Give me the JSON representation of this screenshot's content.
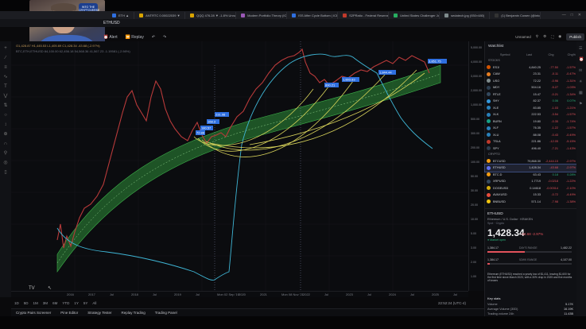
{
  "browser": {
    "tabs": [
      {
        "label": "ETH ▲",
        "color": "#2f6fe0"
      },
      {
        "label": "ANTRTC 0.00022039 ▼",
        "color": "#d9a400"
      },
      {
        "label": "QQQ 476.28 ▼ -1.8% Unna",
        "color": "#d9a400"
      },
      {
        "label": "Modern Portfolio Theory (ICE",
        "color": "#9b59b6"
      },
      {
        "label": "ISS After Cycle Bottom | ICE",
        "color": "#2f6fe0"
      },
      {
        "label": "S2PRatio - Federal Reserve",
        "color": "#c0392b"
      },
      {
        "label": "United States Challenger Jo",
        "color": "#27ae60"
      },
      {
        "label": "sedatech.jpg (930×480)",
        "color": "#7f8c8d"
      },
      {
        "label": "(1) Benjamin Cowen (@into",
        "color": "#333"
      }
    ],
    "symbol": "ETHUSD"
  },
  "toolbar": {
    "alert": "Alert",
    "replay": "Replay",
    "unnamed": "Unnamed",
    "publish": "Publish"
  },
  "legend": {
    "ohlc": "O1,428.87 H1,445.53 L1,405.69 C1,428.34 -43.68 (-2.97%)",
    "indicator": "BTC,ETH,ETHUSD  84,100.00 62,456.18 54,568.36 41,567.23 -1.19581 (-2.98%)"
  },
  "price_scale": [
    "5,000.00",
    "4,000.00",
    "3,000.00",
    "2,000.00",
    "1,000.00",
    "500.00",
    "300.00",
    "200.00",
    "100.00",
    "50.00",
    "30.00",
    "20.00",
    "10.00",
    "5.00",
    "3.00",
    "2.00",
    "1.00"
  ],
  "time_axis": [
    "2016",
    "2017",
    "Jul",
    "2018",
    "Jul",
    "2019",
    "Jul",
    "Mon 02 Sep '19",
    "2020",
    "2021",
    "Mon 08 Nov '21",
    "2022",
    "Jul",
    "2023",
    "Jul",
    "2024",
    "Jul",
    "2025",
    "Jul"
  ],
  "chart_labels": {
    "p1": "72.88",
    "p2": "180.57",
    "p3": "168.3",
    "p4": "231.98",
    "p5": "890.21",
    "p6": "1,893.83",
    "p7": "1,844.44",
    "current": "3,851.75",
    "left_price": "0.4077"
  },
  "timeframes": [
    "1D",
    "5D",
    "1M",
    "3M",
    "6M",
    "YTD",
    "1Y",
    "5Y",
    "All"
  ],
  "clock": "22:52:24 (UTC-4)",
  "bottom_tabs": [
    "Crypto Pairs Screener",
    "Pine Editor",
    "Strategy Tester",
    "Replay Trading",
    "Trading Panel"
  ],
  "watchlist": {
    "title": "Watchlist",
    "headers": [
      "Symbol",
      "Last",
      "Chg",
      "Chg%"
    ],
    "section1": "STOCKS",
    "section2": "CRYPTO",
    "rows": [
      {
        "sym": "ES1!",
        "last": "4,840.25",
        "chg": "-77.50",
        "pct": "-1.57%",
        "color": "#d35400",
        "dir": "neg"
      },
      {
        "sym": "CAW",
        "last": "23.31",
        "chg": "-0.11",
        "pct": "-0.47%",
        "color": "#e67e22",
        "dir": "neg"
      },
      {
        "sym": "USO",
        "last": "72.22",
        "chg": "-0.96",
        "pct": "-1.31%",
        "color": "#7f8c8d",
        "dir": "neg"
      },
      {
        "sym": "MDY",
        "last": "504.16",
        "chg": "-5.27",
        "pct": "-1.03%",
        "color": "#2c3e50",
        "dir": "neg"
      },
      {
        "sym": "RTLE",
        "last": "15.47",
        "chg": "-0.21",
        "pct": "-1.34%",
        "color": "#34495e",
        "dir": "neg"
      },
      {
        "sym": "SHY",
        "last": "82.37",
        "chg": "0.06",
        "pct": "0.07%",
        "color": "#3498db",
        "dir": "pos"
      },
      {
        "sym": "XLE",
        "last": "83.85",
        "chg": "-1.03",
        "pct": "-1.21%",
        "color": "#2980b9",
        "dir": "neg"
      },
      {
        "sym": "XLK",
        "last": "222.53",
        "chg": "-3.54",
        "pct": "-1.57%",
        "color": "#2980b9",
        "dir": "neg"
      },
      {
        "sym": "BURN",
        "last": "19.80",
        "chg": "-0.35",
        "pct": "-1.74%",
        "color": "#16a085",
        "dir": "neg"
      },
      {
        "sym": "XLF",
        "last": "76.35",
        "chg": "-1.22",
        "pct": "-1.57%",
        "color": "#2980b9",
        "dir": "neg"
      },
      {
        "sym": "XLU",
        "last": "88.08",
        "chg": "-0.43",
        "pct": "-0.49%",
        "color": "#2980b9",
        "dir": "neg"
      },
      {
        "sym": "TSLA",
        "last": "221.86",
        "chg": "-12.05",
        "pct": "-5.15%",
        "color": "#c0392b",
        "dir": "neg"
      },
      {
        "sym": "SPY",
        "last": "496.40",
        "chg": "-7.21",
        "pct": "-1.43%",
        "color": "#2c3e50",
        "dir": "neg"
      },
      {
        "sym": "BTCUSD",
        "last": "79,868.30",
        "chg": "-2,444.15",
        "pct": "-2.97%",
        "color": "#f39c12",
        "dir": "neg"
      },
      {
        "sym": "ETHUSD",
        "last": "1,428.34",
        "chg": "-43.68",
        "pct": "-2.97%",
        "color": "#5d6ff0",
        "dir": "neg",
        "selected": true
      },
      {
        "sym": "BTC.D",
        "last": "63.43",
        "chg": "0.18",
        "pct": "0.28%",
        "color": "#f39c12",
        "dir": "pos"
      },
      {
        "sym": "XRPUSD",
        "last": "1.7719",
        "chg": "-0.0218",
        "pct": "-1.22%",
        "color": "#34495e",
        "dir": "neg"
      },
      {
        "sym": "DOGEUSD",
        "last": "0.14618",
        "chg": "-0.00314",
        "pct": "-2.10%",
        "color": "#d4ac0d",
        "dir": "neg"
      },
      {
        "sym": "AVAXUSD",
        "last": "15.33",
        "chg": "-0.72",
        "pct": "-4.49%",
        "color": "#e74c3c",
        "dir": "neg"
      },
      {
        "sym": "BNBUSD",
        "last": "571.14",
        "chg": "-7.98",
        "pct": "-1.38%",
        "color": "#f1c40f",
        "dir": "neg"
      }
    ]
  },
  "detail": {
    "sym": "ETHUSD",
    "name": "Ethereum / U.S. Dollar · KRAKEN",
    "sub": "Spot · Crypto",
    "price": "1,428.34",
    "change": "-43.68 -2.97%",
    "market": "● Market open",
    "day_lo": "1,384.17",
    "day_hi": "1,482.22",
    "day_label": "DAY'S RANGE",
    "day_pct": 0.44,
    "year_lo": "1,384.17",
    "year_hi": "4,107.00",
    "year_label": "52WK RANGE",
    "year_pct": 0.02,
    "news": "Ethereum (ETHUSD) reached a yearly low of $1,411, leaving $1,600 for the first time since March 2023, with a 30% drop in 2025 and five months of losses",
    "keystats": "Key stats",
    "stats": [
      {
        "k": "Volume",
        "v": "5.17K"
      },
      {
        "k": "Average Volume (30D)",
        "v": "16.19K"
      },
      {
        "k": "Trading volume 24h",
        "v": "11.43B"
      }
    ]
  },
  "webcam_badge": "INTO THE CRYPTOVERSE"
}
